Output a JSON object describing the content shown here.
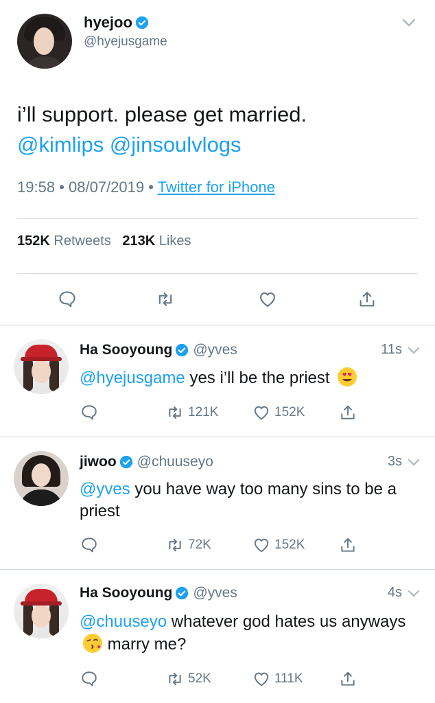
{
  "main_tweet": {
    "name": "hyejoo",
    "handle": "@hyejusgame",
    "text_line1": "i’ll support. please get married.",
    "mention1": "@kimlips",
    "mention2": "@jinsoulvlogs",
    "time": "19:58",
    "date": "08/07/2019",
    "source": "Twitter for iPhone",
    "retweets_count": "152K",
    "retweets_label": "Retweets",
    "likes_count": "213K",
    "likes_label": "Likes"
  },
  "replies": [
    {
      "name": "Ha Sooyoung",
      "handle": "@yves",
      "time": "11s",
      "mention": "@hyejusgame",
      "text": "yes i’ll be the priest",
      "emoji": "heart-eyes-emoji",
      "retweets": "121K",
      "likes": "152K"
    },
    {
      "name": "jiwoo",
      "handle": "@chuuseyo",
      "time": "3s",
      "mention": "@yves",
      "text": "you have way too many sins to be a priest",
      "retweets": "72K",
      "likes": "152K"
    },
    {
      "name": "Ha Sooyoung",
      "handle": "@yves",
      "time": "4s",
      "mention": "@chuuseyo",
      "text_a": "whatever god hates us anyways",
      "emoji": "kiss-emoji",
      "text_b": "marry me?",
      "retweets": "52K",
      "likes": "111K"
    }
  ],
  "colors": {
    "link": "#1da1f2",
    "secondary_text": "#657786",
    "primary_text": "#14171a",
    "verified": "#1da1f2"
  },
  "icons": [
    "reply-icon",
    "retweet-icon",
    "like-icon",
    "share-icon",
    "verified-icon",
    "chevron-down-icon"
  ]
}
